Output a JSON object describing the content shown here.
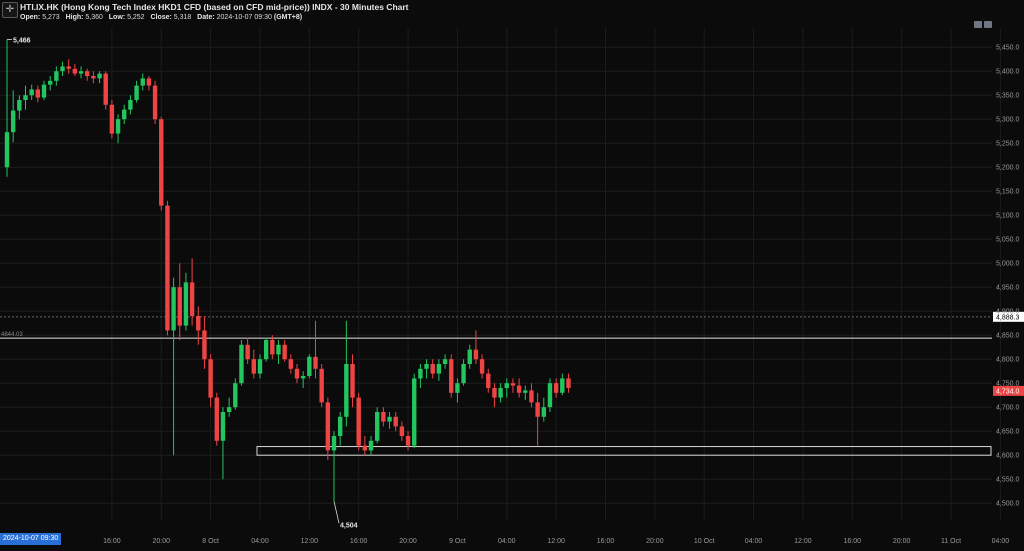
{
  "header": {
    "crosshair_icon": "crosshair-icon",
    "title": "HTI.IX.HK (Hong Kong Tech Index HKD1 CFD (based on CFD mid-price)) INDX - 30 Minutes Chart",
    "ohlc": {
      "open_label": "Open:",
      "open": "5,273",
      "high_label": "High:",
      "high": "5,360",
      "low_label": "Low:",
      "low": "5,252",
      "close_label": "Close:",
      "close": "5,318",
      "date_label": "Date:",
      "date": "2024-10-07 09:30",
      "tz": "(GMT+8)"
    },
    "toolbar_icons": [
      "camera-icon",
      "settings-icon"
    ]
  },
  "cursor_date": "2024-10-07 09:30",
  "colors": {
    "background": "#0b0b0c",
    "up": "#22c55e",
    "down": "#ef4444",
    "grid": "#1c1c1c",
    "line": "#e6e6e6",
    "price_badge": "#ef4444",
    "level_badge": "#ffffff"
  },
  "chart_data": {
    "type": "candlestick",
    "interval": "30 Minutes",
    "ylim": [
      4465,
      5490
    ],
    "y_ticks": [
      {
        "v": 4500,
        "label": "4,500.0"
      },
      {
        "v": 4550,
        "label": "4,550.0"
      },
      {
        "v": 4600,
        "label": "4,600.0"
      },
      {
        "v": 4650,
        "label": "4,650.0"
      },
      {
        "v": 4700,
        "label": "4,700.0"
      },
      {
        "v": 4750,
        "label": "4,750.0"
      },
      {
        "v": 4800,
        "label": "4,800.0"
      },
      {
        "v": 4850,
        "label": "4,850.0"
      },
      {
        "v": 4900,
        "label": "4,900.0"
      },
      {
        "v": 4950,
        "label": "4,950.0"
      },
      {
        "v": 5000,
        "label": "5,000.0"
      },
      {
        "v": 5050,
        "label": "5,050.0"
      },
      {
        "v": 5100,
        "label": "5,100.0"
      },
      {
        "v": 5150,
        "label": "5,150.0"
      },
      {
        "v": 5200,
        "label": "5,200.0"
      },
      {
        "v": 5250,
        "label": "5,250.0"
      },
      {
        "v": 5300,
        "label": "5,300.0"
      },
      {
        "v": 5350,
        "label": "5,350.0"
      },
      {
        "v": 5400,
        "label": "5,400.0"
      },
      {
        "v": 5450,
        "label": "5,450.0"
      }
    ],
    "x_ticks": [
      "16:00",
      "20:00",
      "8 Oct",
      "04:00",
      "12:00",
      "16:00",
      "20:00",
      "9 Oct",
      "04:00",
      "12:00",
      "16:00",
      "20:00",
      "10 Oct",
      "04:00",
      "12:00",
      "16:00",
      "20:00",
      "11 Oct",
      "04:00"
    ],
    "x_tick_index": [
      17,
      25,
      33,
      41,
      49,
      57,
      65,
      73,
      81,
      89,
      97,
      105,
      113,
      121,
      129,
      137,
      145,
      153,
      161
    ],
    "candles": [
      [
        5200,
        5466,
        5180,
        5273
      ],
      [
        5273,
        5360,
        5252,
        5318
      ],
      [
        5318,
        5350,
        5300,
        5340
      ],
      [
        5340,
        5370,
        5320,
        5350
      ],
      [
        5350,
        5372,
        5340,
        5362
      ],
      [
        5362,
        5370,
        5335,
        5345
      ],
      [
        5345,
        5380,
        5340,
        5372
      ],
      [
        5372,
        5390,
        5360,
        5380
      ],
      [
        5380,
        5410,
        5370,
        5400
      ],
      [
        5400,
        5420,
        5390,
        5410
      ],
      [
        5410,
        5425,
        5395,
        5405
      ],
      [
        5405,
        5415,
        5390,
        5395
      ],
      [
        5395,
        5410,
        5385,
        5400
      ],
      [
        5400,
        5405,
        5380,
        5390
      ],
      [
        5390,
        5400,
        5375,
        5385
      ],
      [
        5385,
        5400,
        5375,
        5395
      ],
      [
        5395,
        5400,
        5320,
        5330
      ],
      [
        5330,
        5340,
        5260,
        5270
      ],
      [
        5270,
        5310,
        5250,
        5300
      ],
      [
        5300,
        5330,
        5290,
        5320
      ],
      [
        5320,
        5350,
        5310,
        5340
      ],
      [
        5340,
        5380,
        5335,
        5370
      ],
      [
        5370,
        5395,
        5360,
        5385
      ],
      [
        5385,
        5390,
        5360,
        5370
      ],
      [
        5370,
        5380,
        5290,
        5300
      ],
      [
        5300,
        5305,
        5110,
        5120
      ],
      [
        5120,
        5130,
        4850,
        4860
      ],
      [
        4860,
        4970,
        4600,
        4950
      ],
      [
        4950,
        5000,
        4840,
        4870
      ],
      [
        4870,
        4980,
        4860,
        4960
      ],
      [
        4960,
        5010,
        4870,
        4890
      ],
      [
        4890,
        4910,
        4830,
        4860
      ],
      [
        4860,
        4890,
        4780,
        4800
      ],
      [
        4800,
        4810,
        4700,
        4720
      ],
      [
        4720,
        4730,
        4620,
        4630
      ],
      [
        4630,
        4700,
        4550,
        4690
      ],
      [
        4690,
        4720,
        4680,
        4700
      ],
      [
        4700,
        4760,
        4695,
        4750
      ],
      [
        4750,
        4840,
        4745,
        4830
      ],
      [
        4830,
        4845,
        4790,
        4800
      ],
      [
        4800,
        4820,
        4760,
        4770
      ],
      [
        4770,
        4810,
        4760,
        4800
      ],
      [
        4800,
        4845,
        4795,
        4840
      ],
      [
        4840,
        4850,
        4800,
        4810
      ],
      [
        4810,
        4840,
        4790,
        4830
      ],
      [
        4830,
        4840,
        4795,
        4800
      ],
      [
        4800,
        4810,
        4770,
        4780
      ],
      [
        4780,
        4790,
        4750,
        4760
      ],
      [
        4760,
        4775,
        4740,
        4765
      ],
      [
        4765,
        4810,
        4760,
        4805
      ],
      [
        4805,
        4880,
        4760,
        4780
      ],
      [
        4780,
        4790,
        4700,
        4710
      ],
      [
        4710,
        4720,
        4590,
        4610
      ],
      [
        4610,
        4650,
        4504,
        4640
      ],
      [
        4640,
        4690,
        4620,
        4680
      ],
      [
        4680,
        4880,
        4660,
        4790
      ],
      [
        4790,
        4810,
        4700,
        4720
      ],
      [
        4720,
        4730,
        4610,
        4620
      ],
      [
        4620,
        4640,
        4600,
        4610
      ],
      [
        4610,
        4640,
        4600,
        4630
      ],
      [
        4630,
        4700,
        4625,
        4690
      ],
      [
        4690,
        4700,
        4660,
        4670
      ],
      [
        4670,
        4690,
        4655,
        4680
      ],
      [
        4680,
        4690,
        4650,
        4660
      ],
      [
        4660,
        4670,
        4630,
        4640
      ],
      [
        4640,
        4650,
        4610,
        4620
      ],
      [
        4620,
        4770,
        4615,
        4760
      ],
      [
        4760,
        4790,
        4740,
        4780
      ],
      [
        4780,
        4800,
        4760,
        4790
      ],
      [
        4790,
        4800,
        4760,
        4770
      ],
      [
        4770,
        4800,
        4755,
        4790
      ],
      [
        4790,
        4810,
        4780,
        4800
      ],
      [
        4800,
        4810,
        4720,
        4730
      ],
      [
        4730,
        4760,
        4710,
        4750
      ],
      [
        4750,
        4800,
        4745,
        4790
      ],
      [
        4790,
        4830,
        4780,
        4820
      ],
      [
        4820,
        4860,
        4790,
        4800
      ],
      [
        4800,
        4810,
        4760,
        4770
      ],
      [
        4770,
        4780,
        4730,
        4740
      ],
      [
        4740,
        4750,
        4700,
        4720
      ],
      [
        4720,
        4750,
        4710,
        4740
      ],
      [
        4740,
        4760,
        4720,
        4750
      ],
      [
        4750,
        4760,
        4730,
        4745
      ],
      [
        4745,
        4760,
        4720,
        4730
      ],
      [
        4730,
        4745,
        4715,
        4735
      ],
      [
        4735,
        4750,
        4700,
        4710
      ],
      [
        4710,
        4730,
        4620,
        4680
      ],
      [
        4680,
        4720,
        4670,
        4700
      ],
      [
        4700,
        4760,
        4690,
        4750
      ],
      [
        4750,
        4760,
        4720,
        4730
      ],
      [
        4730,
        4770,
        4725,
        4760
      ],
      [
        4760,
        4770,
        4730,
        4740
      ]
    ],
    "annotations": [
      {
        "label": "5,466",
        "price": 5466,
        "candle": 0
      },
      {
        "label": "4,504",
        "price": 4504,
        "candle": 53
      }
    ],
    "levels": [
      {
        "price": 4888.3,
        "label": "4,888.3",
        "style": "dotted"
      },
      {
        "price": 4844.03,
        "label": "4844.03",
        "style": "solid"
      }
    ],
    "zone": {
      "from": 4600,
      "to": 4618
    },
    "last_price": {
      "price": 4734.0,
      "label": "4,734.0"
    }
  }
}
